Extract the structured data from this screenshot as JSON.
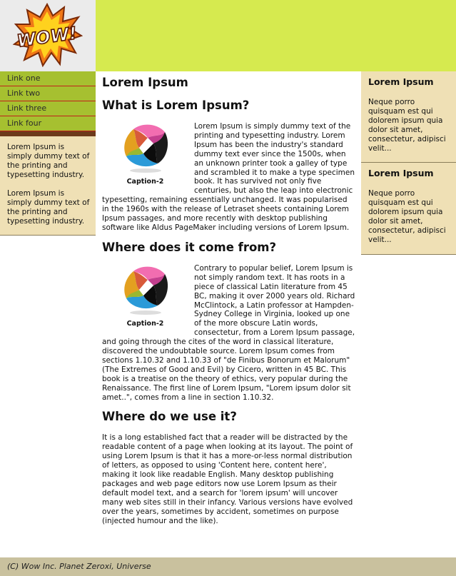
{
  "header": {
    "logo_text": "WOW!"
  },
  "nav": {
    "links": [
      "Link one",
      "Link two",
      "Link three",
      "Link four"
    ]
  },
  "left_sidebar": {
    "paragraphs": [
      "Lorem Ipsum is simply dummy text of the printing and typesetting industry.",
      "Lorem Ipsum is simply dummy text of the printing and typesetting industry."
    ]
  },
  "right_sidebar": {
    "boxes": [
      {
        "title": "Lorem Ipsum",
        "text": "Neque porro quisquam est qui dolorem ipsum quia dolor sit amet, consectetur, adipisci velit..."
      },
      {
        "title": "Lorem Ipsum",
        "text": "Neque porro quisquam est qui dolorem ipsum quia dolor sit amet, consectetur, adipisci velit..."
      }
    ]
  },
  "main": {
    "title": "Lorem Ipsum",
    "sections": [
      {
        "heading": "What is Lorem Ipsum?",
        "caption": "Caption-2",
        "text": "Lorem Ipsum is simply dummy text of the printing and typesetting industry. Lorem Ipsum has been the industry's standard dummy text ever since the 1500s, when an unknown printer took a galley of type and scrambled it to make a type specimen book. It has survived not only five centuries, but also the leap into electronic typesetting, remaining essentially unchanged. It was popularised in the 1960s with the release of Letraset sheets containing Lorem Ipsum passages, and more recently with desktop publishing software like Aldus PageMaker including versions of Lorem Ipsum."
      },
      {
        "heading": "Where does it come from?",
        "caption": "Caption-2",
        "text": "Contrary to popular belief, Lorem Ipsum is not simply random text. It has roots in a piece of classical Latin literature from 45 BC, making it over 2000 years old. Richard McClintock, a Latin professor at Hampden-Sydney College in Virginia, looked up one of the more obscure Latin words, consectetur, from a Lorem Ipsum passage, and going through the cites of the word in classical literature, discovered the undoubtable source. Lorem Ipsum comes from sections 1.10.32 and 1.10.33 of \"de Finibus Bonorum et Malorum\" (The Extremes of Good and Evil) by Cicero, written in 45 BC. This book is a treatise on the theory of ethics, very popular during the Renaissance. The first line of Lorem Ipsum, \"Lorem ipsum dolor sit amet..\", comes from a line in section 1.10.32."
      },
      {
        "heading": "Where do we use it?",
        "text": "It is a long established fact that a reader will be distracted by the readable content of a page when looking at its layout. The point of using Lorem Ipsum is that it has a more-or-less normal distribution of letters, as opposed to using 'Content here, content here', making it look like readable English. Many desktop publishing packages and web page editors now use Lorem Ipsum as their default model text, and a search for 'lorem ipsum' will uncover many web sites still in their infancy. Various versions have evolved over the years, sometimes by accident, sometimes on purpose (injected humour and the like)."
      }
    ]
  },
  "footer": {
    "text": "(C) Wow Inc. Planet Zeroxi, Universe"
  },
  "colors": {
    "banner": "#d6ea4f",
    "nav": "#a6c030",
    "nav_divider": "#c1201b",
    "sidebar_box": "#efe0b5",
    "footer": "#c9c19e"
  }
}
